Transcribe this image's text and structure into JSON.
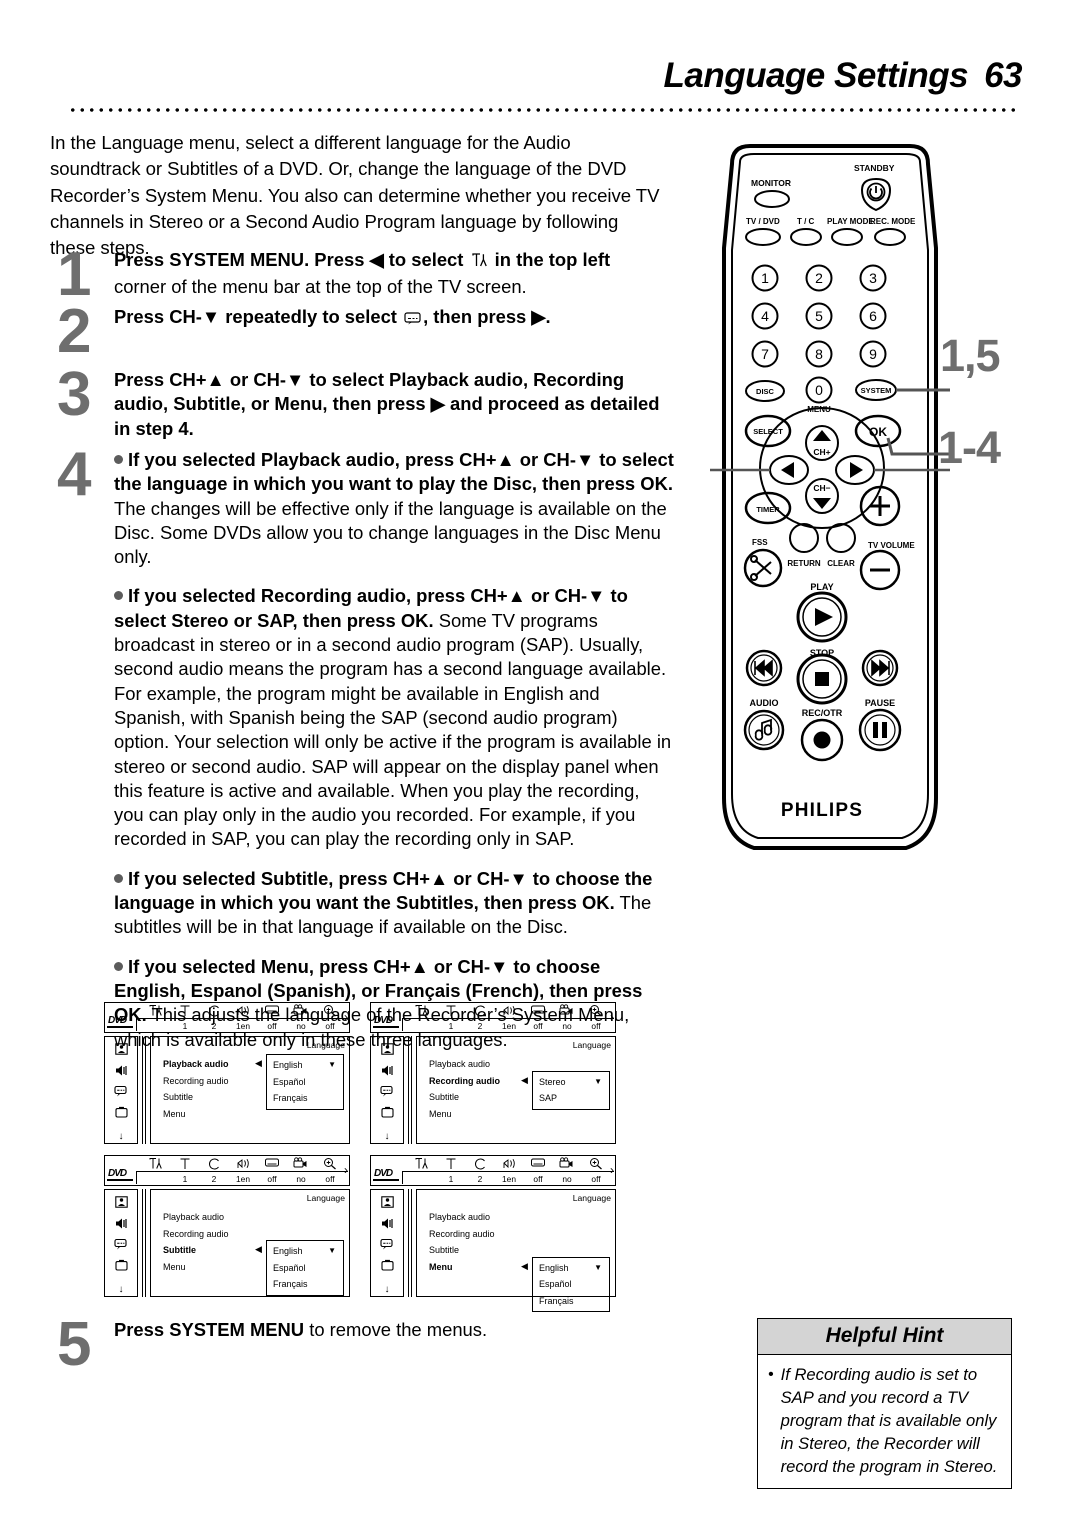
{
  "header": {
    "title": "Language Settings",
    "page_number": "63"
  },
  "intro": "In the Language menu, select a different language for the Audio soundtrack or Subtitles of a DVD. Or, change the language of the DVD Recorder’s System Menu. You also can determine whether you receive TV channels in Stereo or a Second Audio Program language by following these steps.",
  "steps": {
    "one": {
      "number": "1",
      "bold_a": "Press SYSTEM MENU. Press ◀ to select",
      "bold_b": "in the top left",
      "plain": "corner of the menu bar at the top of the TV screen."
    },
    "two": {
      "number": "2",
      "bold_a": "Press CH-▼ repeatedly to select",
      "bold_b": ", then press ▶."
    },
    "three": {
      "number": "3",
      "bold": "Press CH+▲ or CH-▼ to select Playback audio, Recording audio, Subtitle, or Menu, then press ▶ and proceed as detailed in step 4."
    },
    "four": {
      "number": "4",
      "b1_bold": "If you selected Playback audio, press CH+▲ or CH-▼ to select the language in which you want to play the Disc, then press OK.",
      "b1_plain": "The changes will be effective only if the language is available on the Disc. Some DVDs allow you to change languages in the Disc Menu only.",
      "b2_bold": "If you selected Recording audio, press CH+▲ or CH-▼ to select Stereo or SAP, then press OK.",
      "b2_plain": "Some TV programs broadcast in stereo or in a second audio program (SAP). Usually, second audio means the program has a second language available. For example, the program might be available in English and Spanish, with Spanish being the SAP (second audio program) option. Your selection will only be active if the program is available in stereo or second audio. SAP will appear on the display panel  when this feature is active and available.",
      "b2_plain2": "When you play the recording, you can play only in the audio you recorded. For example, if you recorded in SAP, you can play the recording only in SAP.",
      "b3_bold": "If you selected Subtitle, press CH+▲ or CH-▼ to choose the language in which you want the Subtitles, then press OK.",
      "b3_plain": "The subtitles will be in that language if available on the Disc.",
      "b4_bold": "If you selected Menu, press CH+▲ or CH-▼ to choose English, Espanol (Spanish), or Français (French), then press OK.",
      "b4_plain": "This adjusts the language of the Recorder’s System Menu, which is available only in these three languages."
    },
    "five": {
      "number": "5",
      "bold": "Press SYSTEM MENU",
      "plain": "to remove the menus."
    }
  },
  "remote": {
    "brand": "PHILIPS",
    "standby": "STANDBY",
    "monitor": "MONITOR",
    "tv_dvd": "TV / DVD",
    "tc": "T / C",
    "play_mode": "PLAY MODE",
    "rec_mode": "REC. MODE",
    "numbers": [
      "1",
      "2",
      "3",
      "4",
      "5",
      "6",
      "7",
      "8",
      "9"
    ],
    "disc": "DISC",
    "zero": "0",
    "system": "SYSTEM",
    "menu": "MENU",
    "select": "SELECT",
    "ok": "OK",
    "ch_plus": "CH+",
    "ch_minus": "CH−",
    "timer": "TIMER",
    "fss": "FSS",
    "return": "RETURN",
    "clear": "CLEAR",
    "tv_volume": "TV VOLUME",
    "play": "PLAY",
    "stop": "STOP",
    "audio": "AUDIO",
    "pause": "PAUSE",
    "rec_otr": "REC/OTR",
    "callouts": {
      "top": "1,5",
      "bottom": "1-4"
    }
  },
  "osd_common": {
    "dvd_logo": "DVD",
    "bar_columns": [
      {
        "icon": "language-icon",
        "value": ""
      },
      {
        "icon": "title-icon",
        "value": "1"
      },
      {
        "icon": "chapter-icon",
        "value": "2"
      },
      {
        "icon": "audio-icon",
        "value": "1en"
      },
      {
        "icon": "subtitle-icon",
        "value": "off"
      },
      {
        "icon": "angle-icon",
        "value": "no"
      },
      {
        "icon": "zoom-icon",
        "value": "off"
      }
    ],
    "sidebar_icons": [
      "picture-icon",
      "sound-icon",
      "language-icon",
      "features-icon"
    ],
    "panel_label": "Language",
    "items": [
      "Playback audio",
      "Recording audio",
      "Subtitle",
      "Menu"
    ]
  },
  "osd_screens": [
    {
      "name": "playback-audio",
      "selected_index": 0,
      "options": [
        "English",
        "Español",
        "Français"
      ]
    },
    {
      "name": "recording-audio",
      "selected_index": 1,
      "options": [
        "Stereo",
        "SAP"
      ]
    },
    {
      "name": "subtitle",
      "selected_index": 2,
      "options": [
        "English",
        "Español",
        "Français"
      ]
    },
    {
      "name": "menu",
      "selected_index": 3,
      "options": [
        "English",
        "Español",
        "Français"
      ]
    }
  ],
  "hint": {
    "title": "Helpful Hint",
    "bullet": "•",
    "text": "If Recording audio is set to SAP and you record a TV program that is available only in Stereo, the Recorder will record the program in Stereo."
  }
}
